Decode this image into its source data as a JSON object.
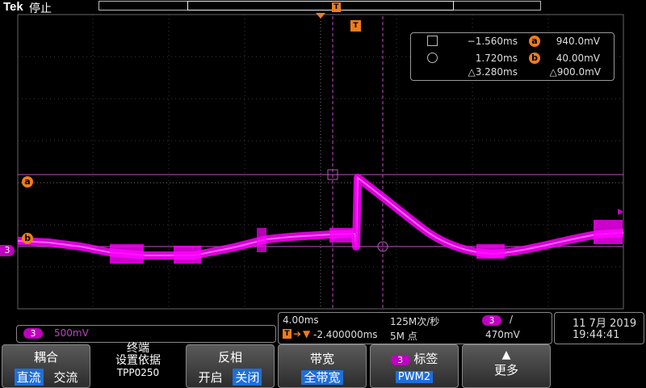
{
  "brand": "Tek",
  "status": "停止",
  "markers": {
    "trigger": "T"
  },
  "cursor_readout": {
    "c1_time": "−1.560ms",
    "c2_time": "1.720ms",
    "delta_time": "△3.280ms",
    "a_label": "a",
    "a_value": "940.0mV",
    "b_label": "b",
    "b_value": "40.00mV",
    "delta_value": "△900.0mV"
  },
  "waveform_labels": {
    "a": "a",
    "b": "b",
    "channel": "3"
  },
  "channel_scale": {
    "channel": "3",
    "value": "500mV"
  },
  "acquisition": {
    "timebase": "4.00ms",
    "sample_rate": "125M次/秒",
    "record_length": "5M 点",
    "trigger_position": "-2.400000ms",
    "trigger_channel": "3",
    "trigger_slope": "/",
    "trigger_level": "470mV"
  },
  "datetime": {
    "date": "11 7月 2019",
    "time": "19:44:41"
  },
  "menu": {
    "coupling": {
      "title": "耦合",
      "option_on": "直流",
      "option_off": "交流"
    },
    "termination": {
      "line1": "终端",
      "line2": "设置依据",
      "line3": "TPP0250"
    },
    "invert": {
      "title": "反相",
      "option_off": "开启",
      "option_on": "关闭"
    },
    "bandwidth": {
      "title": "带宽",
      "value": "全带宽"
    },
    "label": {
      "channel": "3",
      "title": "标签",
      "value": "PWM2"
    },
    "more": {
      "title": "更多"
    }
  },
  "colors": {
    "waveform": "#ff00ff",
    "cursor": "#c040c0",
    "marker": "#f07c1a",
    "grid": "#555555"
  }
}
